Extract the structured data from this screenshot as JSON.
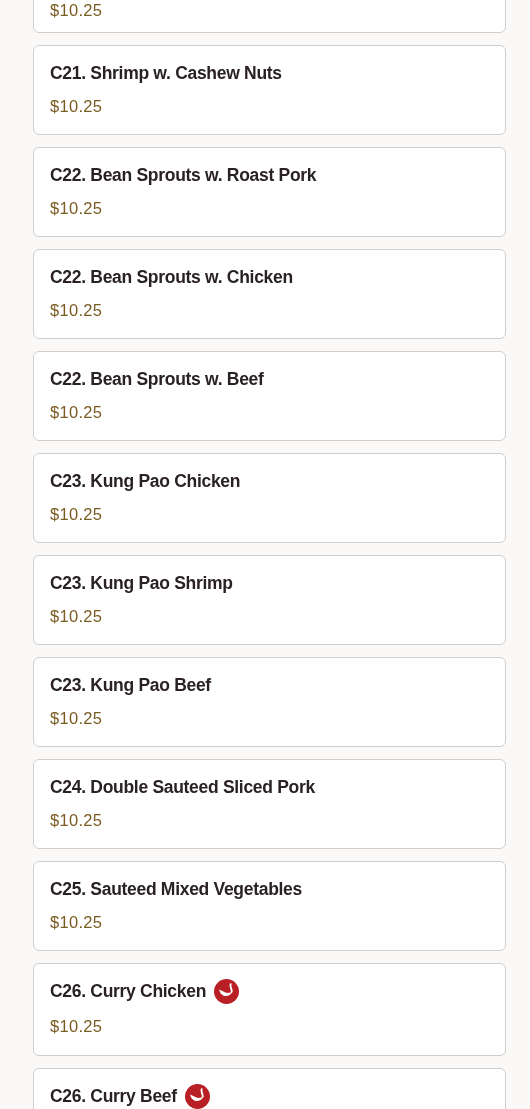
{
  "menu_items": [
    {
      "price": "$10.25"
    },
    {
      "name": "C21. Shrimp w. Cashew Nuts",
      "price": "$10.25",
      "spicy": false
    },
    {
      "name": "C22. Bean Sprouts w. Roast Pork",
      "price": "$10.25",
      "spicy": false
    },
    {
      "name": "C22. Bean Sprouts w. Chicken",
      "price": "$10.25",
      "spicy": false
    },
    {
      "name": "C22. Bean Sprouts w. Beef",
      "price": "$10.25",
      "spicy": false
    },
    {
      "name": "C23. Kung Pao Chicken",
      "price": "$10.25",
      "spicy": false
    },
    {
      "name": "C23. Kung Pao Shrimp",
      "price": "$10.25",
      "spicy": false
    },
    {
      "name": "C23. Kung Pao Beef",
      "price": "$10.25",
      "spicy": false
    },
    {
      "name": "C24. Double Sauteed Sliced Pork",
      "price": "$10.25",
      "spicy": false
    },
    {
      "name": "C25. Sauteed Mixed Vegetables",
      "price": "$10.25",
      "spicy": false
    },
    {
      "name": "C26. Curry Chicken",
      "price": "$10.25",
      "spicy": true
    },
    {
      "name": "C26. Curry Beef",
      "spicy": true
    }
  ]
}
